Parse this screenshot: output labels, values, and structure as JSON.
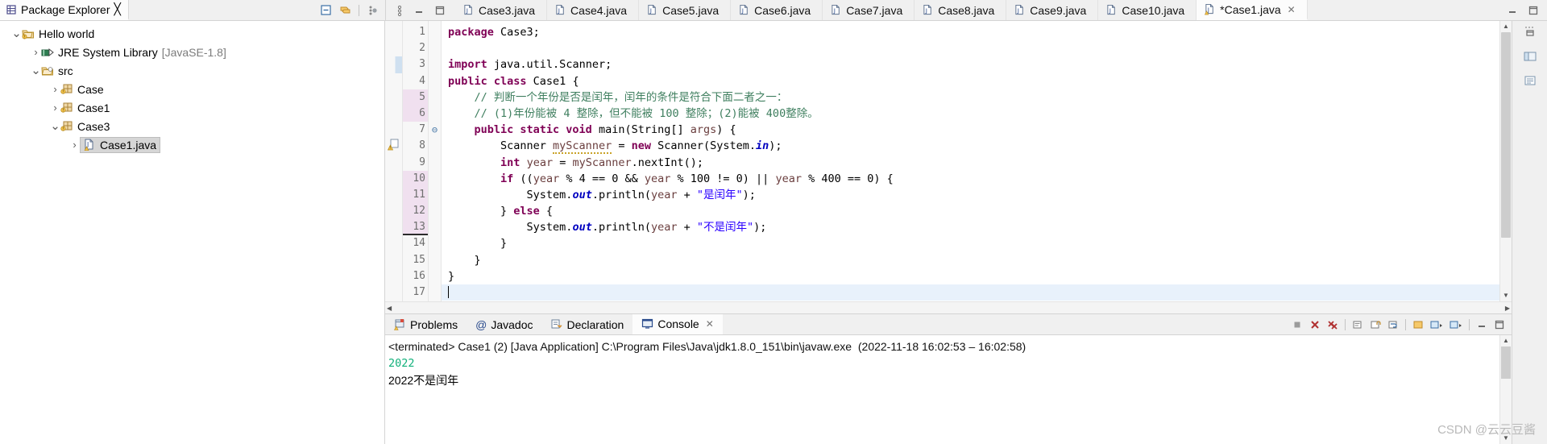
{
  "package_explorer": {
    "tab_label": "Package Explorer",
    "close_icon": "close-icon",
    "view_icon": "package-explorer-icon",
    "toolbar": [
      {
        "name": "collapse-all-button",
        "icon": "collapse-all-icon"
      },
      {
        "name": "link-with-editor-button",
        "icon": "link-editor-icon"
      },
      {
        "name": "view-menu-button",
        "icon": "view-menu-icon"
      }
    ],
    "tree": [
      {
        "label": "Hello world",
        "suffix": "",
        "depth": 0,
        "twisty": "v",
        "icon": "java-project-icon",
        "selected": false
      },
      {
        "label": "JRE System Library",
        "suffix": "[JavaSE-1.8]",
        "depth": 1,
        "twisty": ">",
        "icon": "library-icon",
        "selected": false
      },
      {
        "label": "src",
        "suffix": "",
        "depth": 1,
        "twisty": "v",
        "icon": "source-folder-icon",
        "selected": false
      },
      {
        "label": "Case",
        "suffix": "",
        "depth": 2,
        "twisty": ">",
        "icon": "package-icon",
        "selected": false
      },
      {
        "label": "Case1",
        "suffix": "",
        "depth": 2,
        "twisty": ">",
        "icon": "package-icon",
        "selected": false
      },
      {
        "label": "Case3",
        "suffix": "",
        "depth": 2,
        "twisty": "v",
        "icon": "package-icon",
        "selected": false
      },
      {
        "label": "Case1.java",
        "suffix": "",
        "depth": 3,
        "twisty": ">",
        "icon": "java-file-icon",
        "selected": true
      }
    ]
  },
  "editor": {
    "tabs": [
      {
        "label": "Case3.java",
        "active": false,
        "dirty": false
      },
      {
        "label": "Case4.java",
        "active": false,
        "dirty": false
      },
      {
        "label": "Case5.java",
        "active": false,
        "dirty": false
      },
      {
        "label": "Case6.java",
        "active": false,
        "dirty": false
      },
      {
        "label": "Case7.java",
        "active": false,
        "dirty": false
      },
      {
        "label": "Case8.java",
        "active": false,
        "dirty": false
      },
      {
        "label": "Case9.java",
        "active": false,
        "dirty": false
      },
      {
        "label": "Case10.java",
        "active": false,
        "dirty": false
      },
      {
        "label": "*Case1.java",
        "active": true,
        "dirty": true
      }
    ],
    "window_controls": [
      {
        "name": "minimize-button",
        "icon": "minimize-icon"
      },
      {
        "name": "maximize-button",
        "icon": "maximize-icon"
      }
    ],
    "line_numbers": [
      "1",
      "2",
      "3",
      "4",
      "5",
      "6",
      "7",
      "8",
      "9",
      "10",
      "11",
      "12",
      "13",
      "14",
      "15",
      "16",
      "17"
    ],
    "highlighted_gutter_lines": [
      5,
      6,
      10,
      11,
      12,
      13
    ],
    "cursor_line": 17,
    "fold_markers": {
      "7": "⊖"
    },
    "marker_lines": {
      "8": "warning-marker-icon"
    },
    "changed_bar_lines": [
      3
    ],
    "code_lines": [
      {
        "n": 1,
        "tokens": [
          {
            "t": "package",
            "c": "kw"
          },
          {
            "t": " Case3;",
            "c": "plain"
          }
        ]
      },
      {
        "n": 2,
        "tokens": [
          {
            "t": "",
            "c": "plain"
          }
        ]
      },
      {
        "n": 3,
        "tokens": [
          {
            "t": "import",
            "c": "kw"
          },
          {
            "t": " java.util.Scanner;",
            "c": "plain"
          }
        ]
      },
      {
        "n": 4,
        "tokens": [
          {
            "t": "public class",
            "c": "kw"
          },
          {
            "t": " Case1 {",
            "c": "plain"
          }
        ]
      },
      {
        "n": 5,
        "tokens": [
          {
            "t": "    // 判断一个年份是否是闰年，闰年的条件是符合下面二者之一：",
            "c": "cmt"
          }
        ]
      },
      {
        "n": 6,
        "tokens": [
          {
            "t": "    // (1)年份能被 4 整除，但不能被 100 整除；(2)能被 400整除。",
            "c": "cmt"
          }
        ]
      },
      {
        "n": 7,
        "tokens": [
          {
            "t": "    ",
            "c": "plain"
          },
          {
            "t": "public static void",
            "c": "kw"
          },
          {
            "t": " main(String[] ",
            "c": "plain"
          },
          {
            "t": "args",
            "c": "lvar"
          },
          {
            "t": ") {",
            "c": "plain"
          }
        ]
      },
      {
        "n": 8,
        "tokens": [
          {
            "t": "        Scanner ",
            "c": "plain"
          },
          {
            "t": "myScanner",
            "c": "lvar squig"
          },
          {
            "t": " = ",
            "c": "plain"
          },
          {
            "t": "new",
            "c": "kw"
          },
          {
            "t": " Scanner(System.",
            "c": "plain"
          },
          {
            "t": "in",
            "c": "fld"
          },
          {
            "t": ");",
            "c": "plain"
          }
        ]
      },
      {
        "n": 9,
        "tokens": [
          {
            "t": "        ",
            "c": "plain"
          },
          {
            "t": "int",
            "c": "kw"
          },
          {
            "t": " ",
            "c": "plain"
          },
          {
            "t": "year",
            "c": "lvar"
          },
          {
            "t": " = ",
            "c": "plain"
          },
          {
            "t": "myScanner",
            "c": "lvar"
          },
          {
            "t": ".nextInt();",
            "c": "plain"
          }
        ]
      },
      {
        "n": 10,
        "tokens": [
          {
            "t": "        ",
            "c": "plain"
          },
          {
            "t": "if",
            "c": "kw"
          },
          {
            "t": " ((",
            "c": "plain"
          },
          {
            "t": "year",
            "c": "lvar"
          },
          {
            "t": " % 4 == 0 && ",
            "c": "plain"
          },
          {
            "t": "year",
            "c": "lvar"
          },
          {
            "t": " % 100 != 0) || ",
            "c": "plain"
          },
          {
            "t": "year",
            "c": "lvar"
          },
          {
            "t": " % 400 == 0) {",
            "c": "plain"
          }
        ]
      },
      {
        "n": 11,
        "tokens": [
          {
            "t": "            System.",
            "c": "plain"
          },
          {
            "t": "out",
            "c": "fld"
          },
          {
            "t": ".println(",
            "c": "plain"
          },
          {
            "t": "year",
            "c": "lvar"
          },
          {
            "t": " + ",
            "c": "plain"
          },
          {
            "t": "\"是闰年\"",
            "c": "str"
          },
          {
            "t": ");",
            "c": "plain"
          }
        ]
      },
      {
        "n": 12,
        "tokens": [
          {
            "t": "        } ",
            "c": "plain"
          },
          {
            "t": "else",
            "c": "kw"
          },
          {
            "t": " {",
            "c": "plain"
          }
        ]
      },
      {
        "n": 13,
        "tokens": [
          {
            "t": "            System.",
            "c": "plain"
          },
          {
            "t": "out",
            "c": "fld"
          },
          {
            "t": ".println(",
            "c": "plain"
          },
          {
            "t": "year",
            "c": "lvar"
          },
          {
            "t": " + ",
            "c": "plain"
          },
          {
            "t": "\"不是闰年\"",
            "c": "str"
          },
          {
            "t": ");",
            "c": "plain"
          }
        ]
      },
      {
        "n": 14,
        "tokens": [
          {
            "t": "        }",
            "c": "plain"
          }
        ]
      },
      {
        "n": 15,
        "tokens": [
          {
            "t": "    }",
            "c": "plain"
          }
        ]
      },
      {
        "n": 16,
        "tokens": [
          {
            "t": "}",
            "c": "plain"
          }
        ]
      },
      {
        "n": 17,
        "tokens": [
          {
            "t": "",
            "c": "plain"
          }
        ]
      }
    ]
  },
  "bottom_panel": {
    "tabs": [
      {
        "label": "Problems",
        "icon": "problems-icon",
        "active": false,
        "closable": false
      },
      {
        "label": "Javadoc",
        "icon": "javadoc-icon",
        "active": false,
        "closable": false
      },
      {
        "label": "Declaration",
        "icon": "declaration-icon",
        "active": false,
        "closable": false
      },
      {
        "label": "Console",
        "icon": "console-icon",
        "active": true,
        "closable": true
      }
    ],
    "toolbar": [
      {
        "name": "terminate-button",
        "icon": "terminate-icon"
      },
      {
        "name": "remove-launch-button",
        "icon": "remove-icon"
      },
      {
        "name": "remove-all-terminated-button",
        "icon": "remove-all-icon"
      },
      {
        "name": "clear-console-button",
        "icon": "clear-icon"
      },
      {
        "name": "scroll-lock-button",
        "icon": "scroll-lock-icon"
      },
      {
        "name": "word-wrap-button",
        "icon": "word-wrap-icon"
      },
      {
        "name": "pin-console-button",
        "icon": "pin-icon"
      },
      {
        "name": "display-selected-console-button",
        "icon": "display-console-icon"
      },
      {
        "name": "open-console-button",
        "icon": "open-console-icon"
      },
      {
        "name": "minimize-panel-button",
        "icon": "minimize-icon"
      },
      {
        "name": "maximize-panel-button",
        "icon": "maximize-icon"
      }
    ],
    "console": {
      "header": "<terminated> Case1 (2) [Java Application] C:\\Program Files\\Java\\jdk1.8.0_151\\bin\\javaw.exe  (2022-11-18 16:02:53 – 16:02:58)",
      "lines": [
        {
          "text": "2022",
          "style": "out-green"
        },
        {
          "text": "2022不是闰年",
          "style": "out-black"
        }
      ]
    }
  },
  "watermark": "CSDN @云云豆酱",
  "colors": {
    "keyword": "#7f0055",
    "string": "#2a00ff",
    "comment": "#3f7f5f",
    "field": "#0000c0",
    "local_var": "#6a3e3e",
    "console_green": "#10b07a",
    "gutter_highlight": "#f0e0ef",
    "cursor_line": "#e8f1fb",
    "chrome": "#f0f0f0"
  }
}
